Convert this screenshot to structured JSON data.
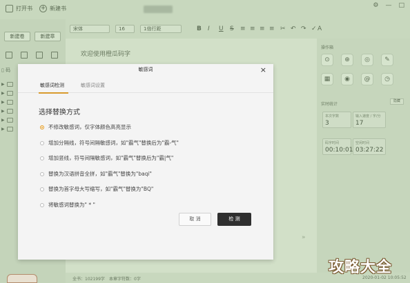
{
  "titlebar": {
    "open_book": "打开书",
    "new_book": "新建书",
    "window_controls": [
      "⚙",
      "—",
      "□"
    ]
  },
  "sidebar": {
    "new_volume": "新建卷",
    "new_chapter": "新建章",
    "tree_label": "码"
  },
  "toolbar": {
    "font": "宋体",
    "font_size": "16",
    "line_spacing": "1倍行距",
    "tools": [
      "B",
      "I",
      "U",
      "S",
      "≡",
      "≡",
      "≡",
      "≡",
      "✂",
      "↶",
      "↷",
      "✓",
      "A"
    ]
  },
  "editor": {
    "welcome": "欢迎使用橙瓜码字"
  },
  "right_panel": {
    "tools_title": "操作箱",
    "stats_title": "实时统计",
    "reset": "隐藏",
    "stats": [
      {
        "label": "本次字数",
        "value": "3"
      },
      {
        "label": "输入速度 / 字/分",
        "value": "17"
      },
      {
        "label": "码字时间",
        "value": "00:10:01"
      },
      {
        "label": "空闲时间",
        "value": "03:27:22"
      }
    ]
  },
  "status": {
    "total": "全书：102199字",
    "chapter": "本章字符数：0字",
    "date": "2020-01-02 10:05:52"
  },
  "modal": {
    "title": "敏感词",
    "tabs": [
      "敏感词检测",
      "敏感词设置"
    ],
    "section_title": "选择替换方式",
    "options": [
      "不修改敏感词，仅字体颜色高亮显示",
      "增加分隔线，符号间隔敏感词，如\"霸气\"替换后为\"霸-气\"",
      "增加竖线，符号间隔敏感词，如\"霸气\"替换后为\"霸|气\"",
      "替换为汉语拼音全拼，如\"霸气\"替换为\"baqi\"",
      "替换为首字母大写缩写，如\"霸气\"替换为\"BQ\"",
      "将敏感词替换为\" * \""
    ],
    "selected_index": 0,
    "cancel": "取 消",
    "detect": "检 测"
  },
  "watermark": "攻略大全",
  "colors": {
    "accent": "#e39b22",
    "app_bg": "#c8d8be",
    "dark_button": "#2f2f2f"
  }
}
